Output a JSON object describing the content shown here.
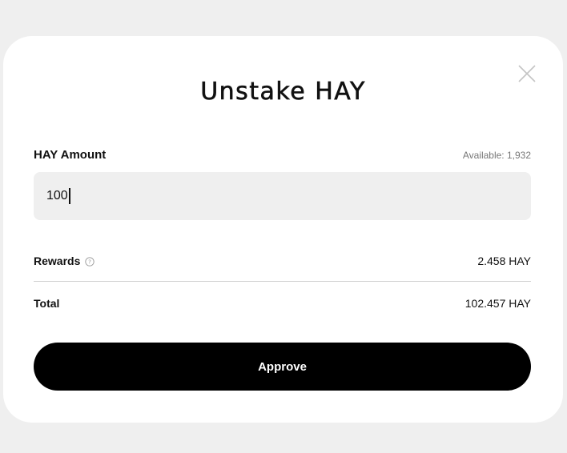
{
  "dialog": {
    "title": "Unstake HAY",
    "close_icon": "close-icon"
  },
  "amount": {
    "label": "HAY Amount",
    "available": "Available: 1,932",
    "value": "100"
  },
  "rewards": {
    "label": "Rewards",
    "help_icon": "question-circle-icon",
    "value": "2.458 HAY"
  },
  "total": {
    "label": "Total",
    "value": "102.457 HAY"
  },
  "actions": {
    "approve_label": "Approve"
  }
}
